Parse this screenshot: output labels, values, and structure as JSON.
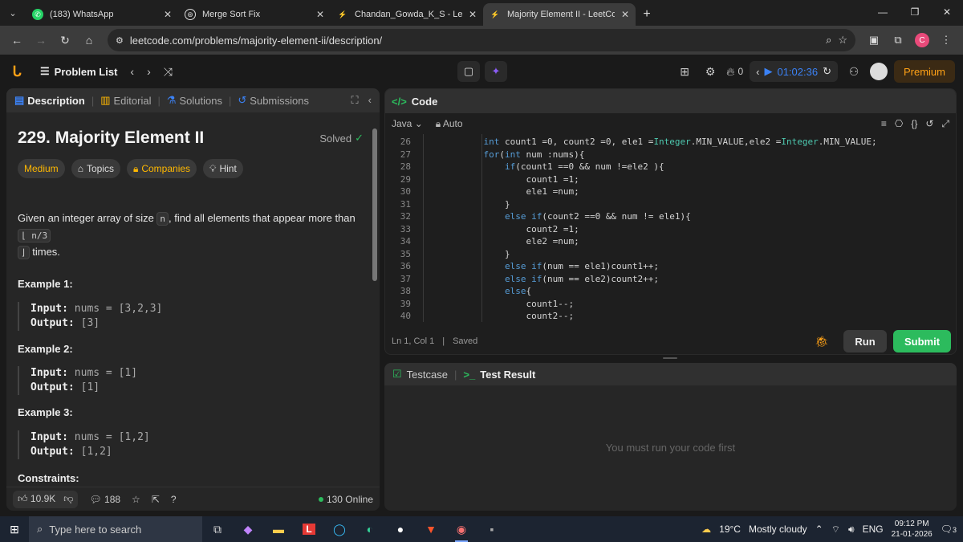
{
  "browser": {
    "tabs": [
      {
        "label": "(183) WhatsApp",
        "icon": "whatsapp-icon",
        "color": "#25d366"
      },
      {
        "label": "Merge Sort Fix",
        "icon": "chatgpt-icon",
        "color": "#dddddd"
      },
      {
        "label": "Chandan_Gowda_K_S - LeetCod",
        "icon": "leetcode-icon",
        "color": "#ffa116"
      },
      {
        "label": "Majority Element II - LeetCode",
        "icon": "leetcode-icon",
        "color": "#ffa116"
      }
    ],
    "url": "leetcode.com/problems/majority-element-ii/description/",
    "profile_initial": "C"
  },
  "lc_header": {
    "problem_list": "Problem List",
    "streak": "0",
    "timer": "01:02:36",
    "premium": "Premium"
  },
  "left_tabs": {
    "description": "Description",
    "editorial": "Editorial",
    "solutions": "Solutions",
    "submissions": "Submissions"
  },
  "problem": {
    "title": "229. Majority Element II",
    "status": "Solved",
    "difficulty": "Medium",
    "topics": "Topics",
    "companies": "Companies",
    "hint": "Hint",
    "desc_1": "Given an integer array of size ",
    "desc_n": "n",
    "desc_2": ", find all elements that appear more than ",
    "desc_floor": "⌊ n/3",
    "desc_floor2": "⌋",
    "desc_3": " times.",
    "examples": [
      {
        "title": "Example 1:",
        "input_label": "Input:",
        "input": "nums = [3,2,3]",
        "output_label": "Output:",
        "output": "[3]"
      },
      {
        "title": "Example 2:",
        "input_label": "Input:",
        "input": "nums = [1]",
        "output_label": "Output:",
        "output": "[1]"
      },
      {
        "title": "Example 3:",
        "input_label": "Input:",
        "input": "nums = [1,2]",
        "output_label": "Output:",
        "output": "[1,2]"
      }
    ],
    "constraints": "Constraints:"
  },
  "footer": {
    "likes": "10.9K",
    "comments": "188",
    "online": "130 Online"
  },
  "code_panel": {
    "title": "Code",
    "language": "Java",
    "mode": "Auto",
    "status_pos": "Ln 1, Col 1",
    "status_saved": "Saved",
    "run": "Run",
    "submit": "Submit",
    "lines": [
      {
        "n": "26",
        "pre": "    ",
        "kw": "int",
        "rest": " count1 =0, count2 =0, ele1 =",
        "cls": "Integer",
        "rest2": ".MIN_VALUE,ele2 =",
        "cls2": "Integer",
        "rest3": ".MIN_VALUE;"
      },
      {
        "n": "27",
        "pre": "    ",
        "kw": "for",
        "rest": "(",
        "cls": "int",
        "rest2": " num :nums){",
        "cls2": "",
        "rest3": ""
      },
      {
        "n": "28",
        "pre": "        ",
        "kw": "if",
        "rest": "(count1 ==0 && num !=ele2 ){",
        "cls": "",
        "rest2": "",
        "cls2": "",
        "rest3": ""
      },
      {
        "n": "29",
        "pre": "            ",
        "kw": "",
        "rest": "count1 =1;",
        "cls": "",
        "rest2": "",
        "cls2": "",
        "rest3": ""
      },
      {
        "n": "30",
        "pre": "            ",
        "kw": "",
        "rest": "ele1 =num;",
        "cls": "",
        "rest2": "",
        "cls2": "",
        "rest3": ""
      },
      {
        "n": "31",
        "pre": "        ",
        "kw": "",
        "rest": "}",
        "cls": "",
        "rest2": "",
        "cls2": "",
        "rest3": ""
      },
      {
        "n": "32",
        "pre": "        ",
        "kw": "else if",
        "rest": "(count2 ==0 && num != ele1){",
        "cls": "",
        "rest2": "",
        "cls2": "",
        "rest3": ""
      },
      {
        "n": "33",
        "pre": "            ",
        "kw": "",
        "rest": "count2 =1;",
        "cls": "",
        "rest2": "",
        "cls2": "",
        "rest3": ""
      },
      {
        "n": "34",
        "pre": "            ",
        "kw": "",
        "rest": "ele2 =num;",
        "cls": "",
        "rest2": "",
        "cls2": "",
        "rest3": ""
      },
      {
        "n": "35",
        "pre": "        ",
        "kw": "",
        "rest": "}",
        "cls": "",
        "rest2": "",
        "cls2": "",
        "rest3": ""
      },
      {
        "n": "36",
        "pre": "        ",
        "kw": "else if",
        "rest": "(num == ele1)count1++;",
        "cls": "",
        "rest2": "",
        "cls2": "",
        "rest3": ""
      },
      {
        "n": "37",
        "pre": "        ",
        "kw": "else if",
        "rest": "(num == ele2)count2++;",
        "cls": "",
        "rest2": "",
        "cls2": "",
        "rest3": ""
      },
      {
        "n": "38",
        "pre": "        ",
        "kw": "else",
        "rest": "{",
        "cls": "",
        "rest2": "",
        "cls2": "",
        "rest3": ""
      },
      {
        "n": "39",
        "pre": "            ",
        "kw": "",
        "rest": "count1--;",
        "cls": "",
        "rest2": "",
        "cls2": "",
        "rest3": ""
      },
      {
        "n": "40",
        "pre": "            ",
        "kw": "",
        "rest": "count2--;",
        "cls": "",
        "rest2": "",
        "cls2": "",
        "rest3": ""
      }
    ]
  },
  "test_panel": {
    "testcase": "Testcase",
    "test_result": "Test Result",
    "message": "You must run your code first"
  },
  "taskbar": {
    "search_placeholder": "Type here to search",
    "temperature": "19°C",
    "weather": "Mostly cloudy",
    "language": "ENG",
    "time": "09:12 PM",
    "date": "21-01-2026",
    "notifications": "3"
  }
}
